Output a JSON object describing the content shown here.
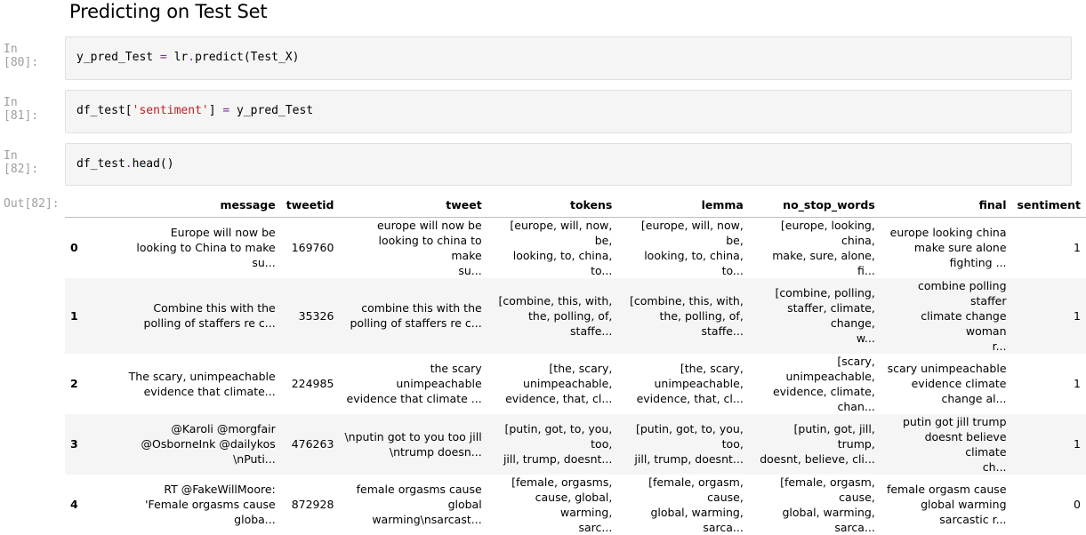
{
  "heading": "Predicting on Test Set",
  "cells": [
    {
      "prompt": "In [80]:",
      "code_parts": [
        "y_pred_Test ",
        "=",
        " lr",
        ".",
        "predict(Test_X)"
      ]
    },
    {
      "prompt": "In [81]:",
      "code_parts": [
        "df_test[",
        "'sentiment'",
        "] ",
        "=",
        " y_pred_Test"
      ]
    },
    {
      "prompt": "In [82]:",
      "code_parts": [
        "df_test",
        ".",
        "head()"
      ]
    }
  ],
  "output_prompt": "Out[82]:",
  "table": {
    "columns": [
      "",
      "message",
      "tweetid",
      "tweet",
      "tokens",
      "lemma",
      "no_stop_words",
      "final",
      "sentiment"
    ],
    "rows": [
      {
        "index": "0",
        "message": [
          "Europe will now be",
          "looking to China to make",
          "su..."
        ],
        "tweetid": "169760",
        "tweet": [
          "europe will now be",
          "looking to china to make",
          "su..."
        ],
        "tokens": [
          "[europe, will, now, be,",
          "looking, to, china, to..."
        ],
        "lemma": [
          "[europe, will, now, be,",
          "looking, to, china, to..."
        ],
        "no_stop_words": [
          "[europe, looking, china,",
          "make, sure, alone, fi..."
        ],
        "final": [
          "europe looking china",
          "make sure alone",
          "fighting ..."
        ],
        "sentiment": "1"
      },
      {
        "index": "1",
        "message": [
          "Combine this with the",
          "polling of staffers re c..."
        ],
        "tweetid": "35326",
        "tweet": [
          "combine this with the",
          "polling of staffers re c..."
        ],
        "tokens": [
          "[combine, this, with,",
          "the, polling, of, staffe..."
        ],
        "lemma": [
          "[combine, this, with,",
          "the, polling, of, staffe..."
        ],
        "no_stop_words": [
          "[combine, polling,",
          "staffer, climate, change,",
          "w..."
        ],
        "final": [
          "combine polling staffer",
          "climate change woman",
          "r..."
        ],
        "sentiment": "1"
      },
      {
        "index": "2",
        "message": [
          "The scary, unimpeachable",
          "evidence that climate..."
        ],
        "tweetid": "224985",
        "tweet": [
          "the scary unimpeachable",
          "evidence that climate ..."
        ],
        "tokens": [
          "[the, scary,",
          "unimpeachable,",
          "evidence, that, cl..."
        ],
        "lemma": [
          "[the, scary,",
          "unimpeachable,",
          "evidence, that, cl..."
        ],
        "no_stop_words": [
          "[scary, unimpeachable,",
          "evidence, climate,",
          "chan..."
        ],
        "final": [
          "scary unimpeachable",
          "evidence climate",
          "change al..."
        ],
        "sentiment": "1"
      },
      {
        "index": "3",
        "message": [
          "@Karoli @morgfair",
          "@OsborneInk @dailykos",
          "\\nPuti..."
        ],
        "tweetid": "476263",
        "tweet": [
          "\\nputin got to you too jill",
          "\\ntrump doesn..."
        ],
        "tokens": [
          "[putin, got, to, you, too,",
          "jill, trump, doesnt..."
        ],
        "lemma": [
          "[putin, got, to, you, too,",
          "jill, trump, doesnt..."
        ],
        "no_stop_words": [
          "[putin, got, jill, trump,",
          "doesnt, believe, cli..."
        ],
        "final": [
          "putin got jill trump",
          "doesnt believe climate",
          "ch..."
        ],
        "sentiment": "1"
      },
      {
        "index": "4",
        "message": [
          "RT @FakeWillMoore:",
          "'Female orgasms cause",
          "globa..."
        ],
        "tweetid": "872928",
        "tweet": [
          "female orgasms cause",
          "global warming\\nsarcast..."
        ],
        "tokens": [
          "[female, orgasms,",
          "cause, global, warming,",
          "sarc..."
        ],
        "lemma": [
          "[female, orgasm, cause,",
          "global, warming, sarca..."
        ],
        "no_stop_words": [
          "[female, orgasm, cause,",
          "global, warming, sarca..."
        ],
        "final": [
          "female orgasm cause",
          "global warming",
          "sarcastic r..."
        ],
        "sentiment": "0"
      }
    ]
  }
}
